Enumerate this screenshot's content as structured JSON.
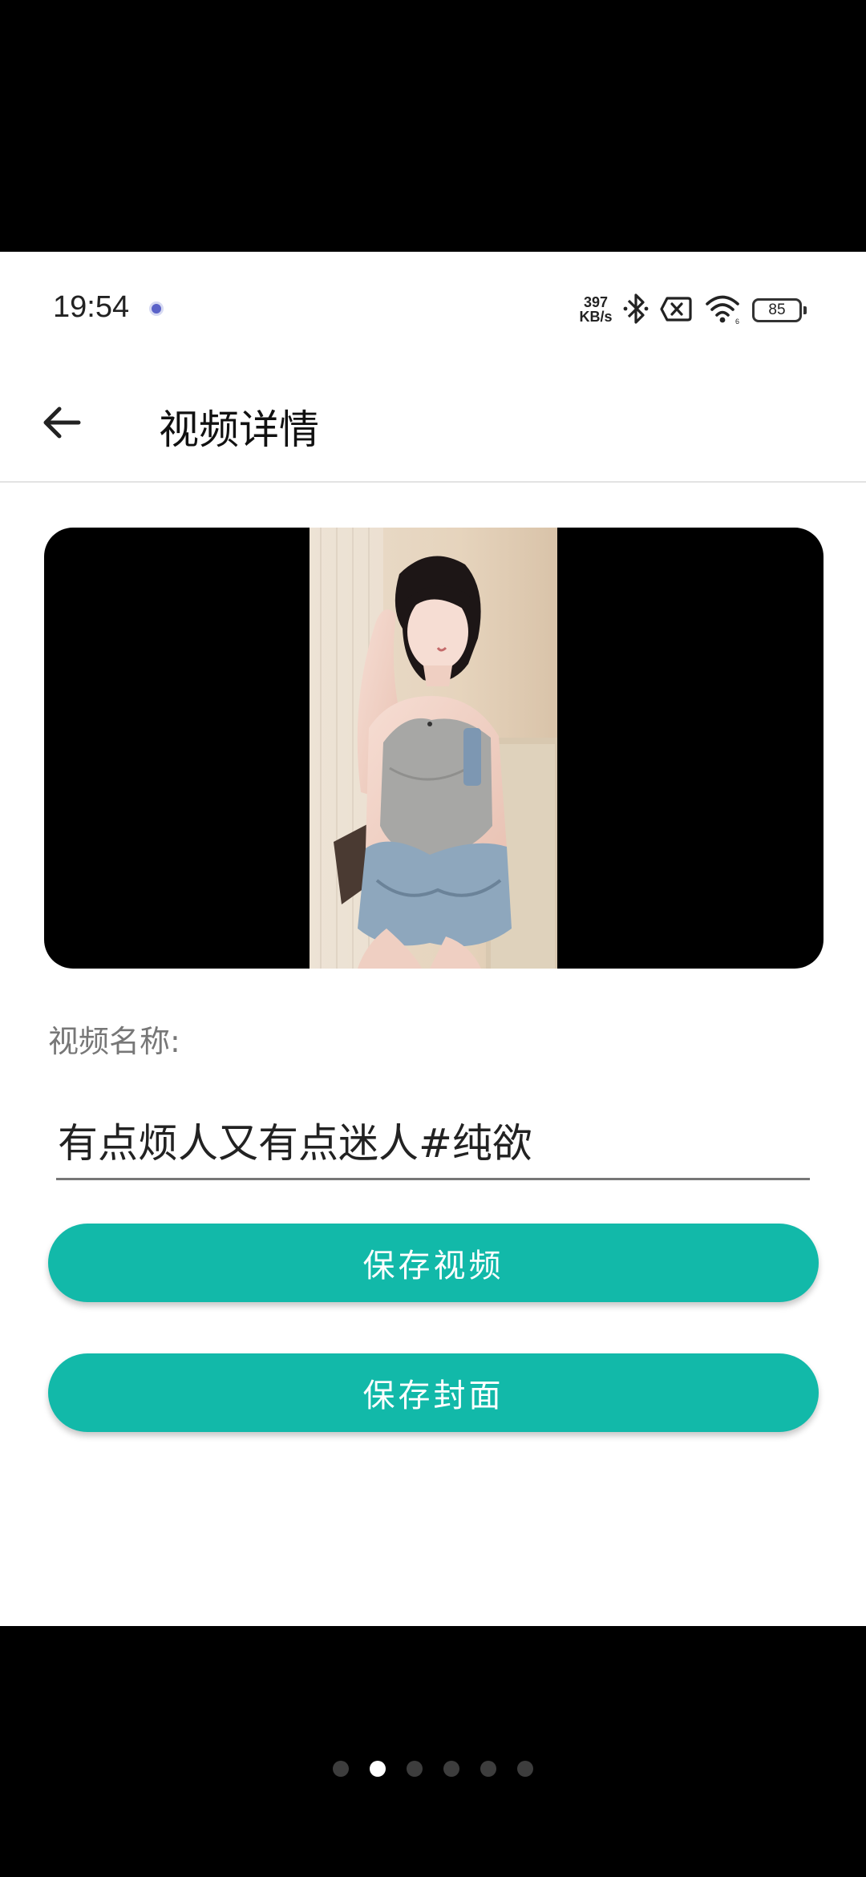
{
  "status_bar": {
    "time": "19:54",
    "net_speed_value": "397",
    "net_speed_unit": "KB/s",
    "battery": "85",
    "icons": [
      "bluetooth-icon",
      "no-sim-icon",
      "wifi-icon",
      "battery-icon"
    ]
  },
  "app_bar": {
    "title": "视频详情",
    "back_icon": "arrow-left-icon"
  },
  "video": {
    "thumbnail_icon": "video-thumbnail-image"
  },
  "form": {
    "name_label": "视频名称:",
    "name_value": "有点烦人又有点迷人#纯欲"
  },
  "actions": {
    "save_video": "保存视频",
    "save_cover": "保存封面"
  },
  "pager": {
    "count": 6,
    "active_index": 1
  },
  "colors": {
    "accent": "#12b9a9",
    "background": "#ffffff",
    "outer": "#000000"
  }
}
